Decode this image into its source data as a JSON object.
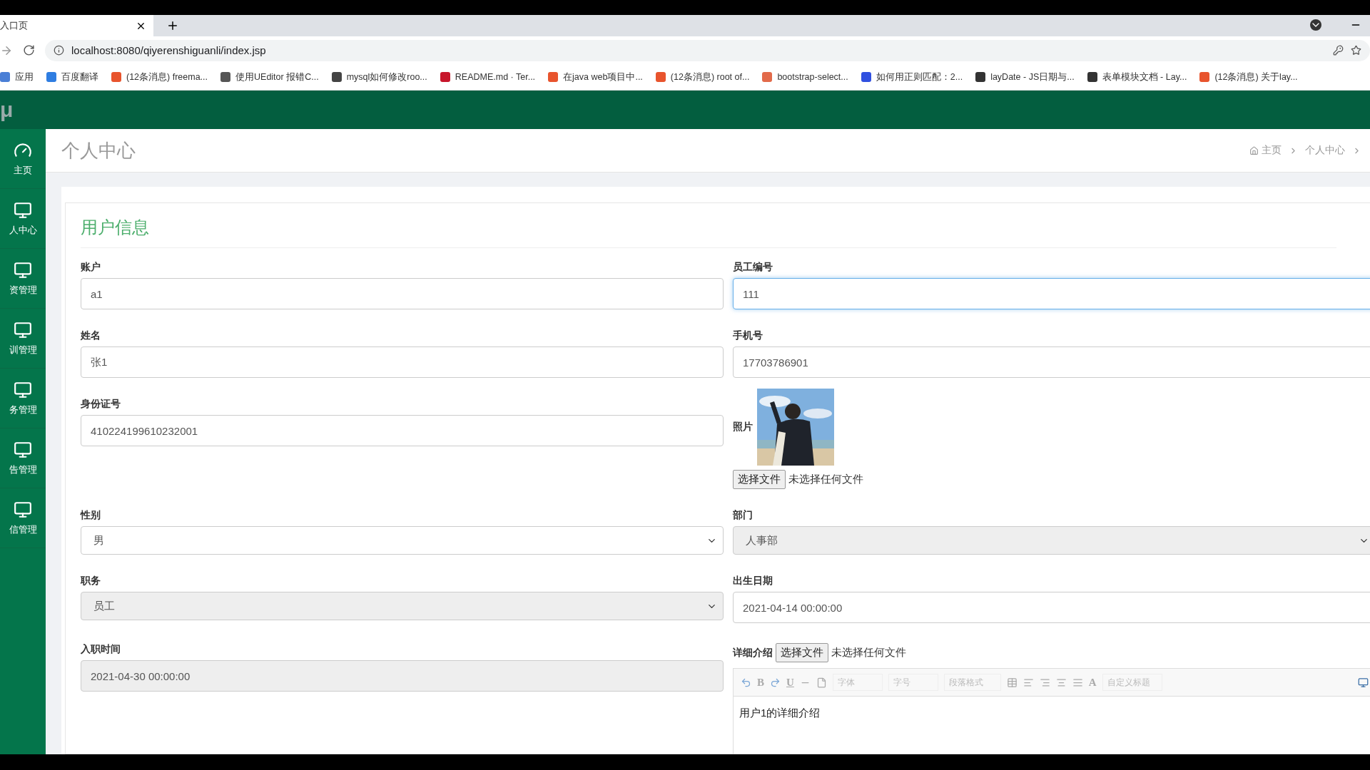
{
  "browser": {
    "tab": {
      "title": "入口页"
    },
    "url": "localhost:8080/qiyerenshiguanli/index.jsp",
    "bookmarks": [
      {
        "label": "应用",
        "color": "#4a7fd6"
      },
      {
        "label": "百度翻译",
        "color": "#2f7de1"
      },
      {
        "label": "(12条消息) freema...",
        "color": "#e8542d"
      },
      {
        "label": "使用UEditor 报错C...",
        "color": "#555555"
      },
      {
        "label": "mysql如何修改roo...",
        "color": "#444444"
      },
      {
        "label": "README.md · Ter...",
        "color": "#c7162b"
      },
      {
        "label": "在java web项目中...",
        "color": "#e8542d"
      },
      {
        "label": "(12条消息) root of...",
        "color": "#e8542d"
      },
      {
        "label": "bootstrap-select...",
        "color": "#e26a4a"
      },
      {
        "label": "如何用正则匹配：2...",
        "color": "#3050e0"
      },
      {
        "label": "layDate - JS日期与...",
        "color": "#333333"
      },
      {
        "label": "表单模块文档 - Lay...",
        "color": "#333333"
      },
      {
        "label": "(12条消息) 关于lay...",
        "color": "#e8542d"
      }
    ]
  },
  "app": {
    "logo": "μ",
    "sidebar": [
      {
        "label": "主页",
        "kind": "dashboard"
      },
      {
        "label": "人中心",
        "kind": "monitor"
      },
      {
        "label": "资管理",
        "kind": "monitor"
      },
      {
        "label": "训管理",
        "kind": "monitor"
      },
      {
        "label": "务管理",
        "kind": "monitor"
      },
      {
        "label": "告管理",
        "kind": "monitor"
      },
      {
        "label": "信管理",
        "kind": "monitor"
      }
    ],
    "page_title": "个人中心",
    "breadcrumb": [
      "主页",
      "个人中心"
    ],
    "card": {
      "title": "用户信息",
      "fields": [
        {
          "label": "账户",
          "kind": "text",
          "value": "a1",
          "disabled": false,
          "focused": false
        },
        {
          "label": "员工编号",
          "kind": "text",
          "value": "111",
          "disabled": false,
          "focused": true
        },
        {
          "label": "姓名",
          "kind": "text",
          "value": "张1",
          "disabled": false,
          "focused": false
        },
        {
          "label": "手机号",
          "kind": "text",
          "value": "17703786901",
          "disabled": false,
          "focused": false
        },
        {
          "label": "身份证号",
          "kind": "text",
          "value": "410224199610232001",
          "disabled": false,
          "focused": false
        },
        {
          "label": "照片",
          "button": "选择文件",
          "file_status": "未选择任何文件"
        },
        {
          "label": "性别",
          "kind": "select",
          "value": "男",
          "disabled": false
        },
        {
          "label": "部门",
          "kind": "select",
          "value": "人事部",
          "disabled": true
        },
        {
          "label": "职务",
          "kind": "select",
          "value": "员工",
          "disabled": true
        },
        {
          "label": "出生日期",
          "kind": "text",
          "value": "2021-04-14 00:00:00",
          "disabled": false,
          "focused": false
        },
        {
          "label": "入职时间",
          "kind": "text",
          "value": "2021-04-30 00:00:00",
          "disabled": true,
          "focused": false
        },
        {
          "label": "详细介绍",
          "kind": "richtext",
          "button": "选择文件",
          "file_status": "未选择任何文件",
          "content": "用户1的详细介绍",
          "toolbar": [
            {
              "kind": "undo"
            },
            {
              "kind": "glyph",
              "label": "B"
            },
            {
              "kind": "redo"
            },
            {
              "kind": "glyph",
              "label": "U"
            },
            {
              "kind": "rule"
            },
            {
              "kind": "page"
            },
            {
              "kind": "select",
              "label": "字体"
            },
            {
              "kind": "select",
              "label": "字号"
            },
            {
              "kind": "select",
              "label": "段落格式"
            },
            {
              "kind": "table"
            },
            {
              "kind": "align-left"
            },
            {
              "kind": "align-right"
            },
            {
              "kind": "align-center"
            },
            {
              "kind": "justify"
            },
            {
              "kind": "color",
              "label": "A"
            },
            {
              "kind": "select",
              "label": "自定义标题"
            },
            {
              "kind": "preview"
            }
          ]
        }
      ]
    }
  }
}
